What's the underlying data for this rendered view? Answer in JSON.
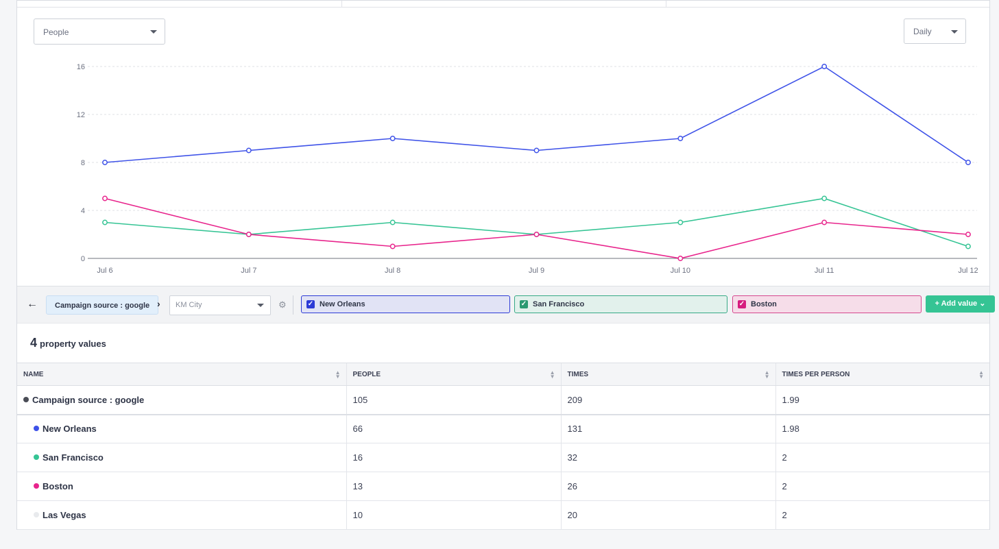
{
  "metric_select": {
    "value": "People"
  },
  "interval_select": {
    "value": "Daily"
  },
  "chart_data": {
    "type": "line",
    "categories": [
      "Jul 6",
      "Jul 7",
      "Jul 8",
      "Jul 9",
      "Jul 10",
      "Jul 11",
      "Jul 12"
    ],
    "yticks": [
      "0",
      "4",
      "8",
      "12",
      "16"
    ],
    "ylim": [
      0,
      16
    ],
    "grid": true,
    "series": [
      {
        "name": "New Orleans",
        "color": "#3e52e8",
        "values": [
          8,
          9,
          10,
          9,
          10,
          16,
          8
        ]
      },
      {
        "name": "San Francisco",
        "color": "#35c494",
        "values": [
          3,
          2,
          3,
          2,
          3,
          5,
          1
        ]
      },
      {
        "name": "Boston",
        "color": "#e8248c",
        "values": [
          5,
          2,
          1,
          2,
          0,
          3,
          2
        ]
      }
    ]
  },
  "controls": {
    "back_icon": "arrow-left-icon",
    "breadcrumb": "Campaign source : google",
    "chevron_icon": "chevron-right-icon",
    "property_select_placeholder": "KM City",
    "settings_icon": "gear-icon",
    "chips": [
      {
        "label": "New Orleans",
        "bg": "#e1e3f5",
        "border": "#2c3ad6",
        "check": "#2c3ad6"
      },
      {
        "label": "San Francisco",
        "bg": "#e2f1ec",
        "border": "#35a985",
        "check": "#2b9a72"
      },
      {
        "label": "Boston",
        "bg": "#f6dde9",
        "border": "#d6478e",
        "check": "#d61c7e"
      }
    ],
    "add_value": "+ Add value"
  },
  "summary": {
    "count": "4",
    "label": "property values"
  },
  "table": {
    "headers": [
      "NAME",
      "PEOPLE",
      "TIMES",
      "TIMES PER PERSON"
    ],
    "parent": {
      "name": "Campaign source : google",
      "color": "#4a4d56",
      "people": "105",
      "times": "209",
      "tpp": "1.99"
    },
    "rows": [
      {
        "name": "New Orleans",
        "color": "#3e52e8",
        "people": "66",
        "times": "131",
        "tpp": "1.98"
      },
      {
        "name": "San Francisco",
        "color": "#35c494",
        "people": "16",
        "times": "32",
        "tpp": "2"
      },
      {
        "name": "Boston",
        "color": "#e8248c",
        "people": "13",
        "times": "26",
        "tpp": "2"
      },
      {
        "name": "Las Vegas",
        "color": "#e8eaed",
        "people": "10",
        "times": "20",
        "tpp": "2"
      }
    ]
  }
}
